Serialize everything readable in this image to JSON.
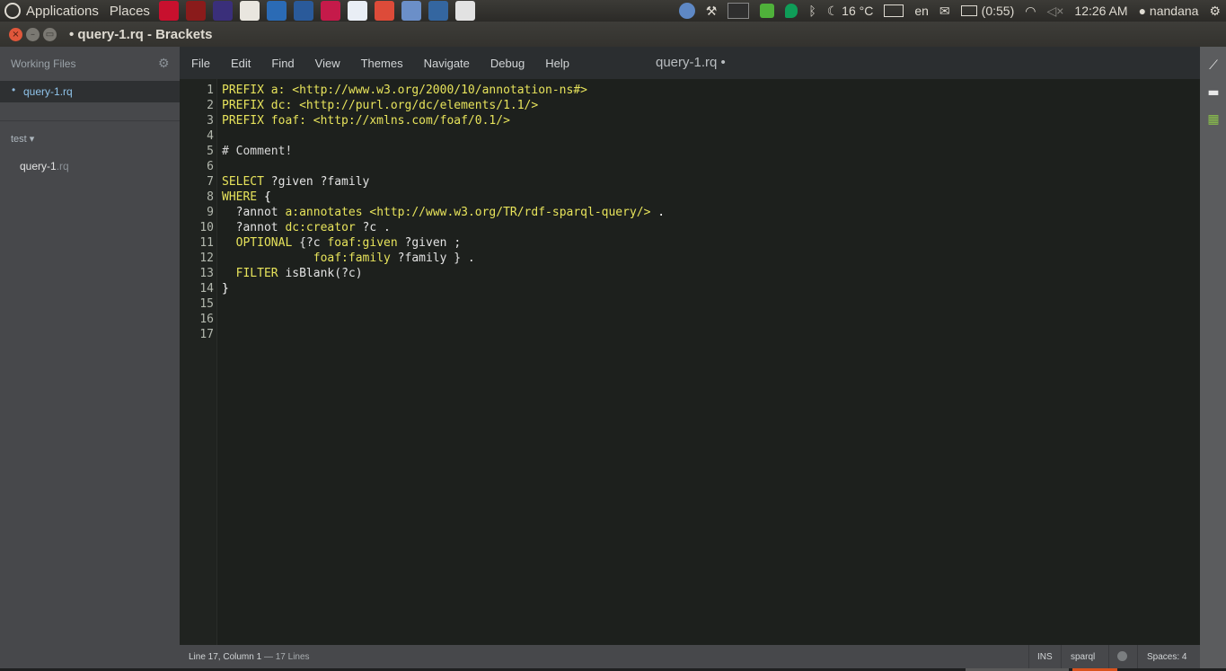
{
  "top_panel": {
    "menus": [
      "Applications",
      "Places"
    ],
    "launcher_icons": [
      {
        "name": "mendeley-icon",
        "color": "#c8102e"
      },
      {
        "name": "terminal-red-icon",
        "color": "#8a1b1b"
      },
      {
        "name": "eclipse-icon",
        "color": "#3a2f7a"
      },
      {
        "name": "text-editor-icon",
        "color": "#e9e6df"
      },
      {
        "name": "monitor-icon",
        "color": "#2b6bb5"
      },
      {
        "name": "update-icon",
        "color": "#2a5a9a"
      },
      {
        "name": "raspberry-icon",
        "color": "#c51a4a"
      },
      {
        "name": "chart-icon",
        "color": "#e9eef5"
      },
      {
        "name": "chrome-icon",
        "color": "#dd4b39"
      },
      {
        "name": "browser-icon",
        "color": "#6b8fc8"
      },
      {
        "name": "window-icon",
        "color": "#3466a0"
      },
      {
        "name": "tex-icon",
        "color": "#e2e2e2"
      }
    ],
    "tray": {
      "weather_temp": "16 °C",
      "keyboard_layout": "en",
      "battery": "(0:55)",
      "clock": "12:26 AM",
      "user": "nandana"
    }
  },
  "window": {
    "title": "• query-1.rq - Brackets",
    "close_glyph": "×",
    "minimize_glyph": "–",
    "maximize_glyph": "▭"
  },
  "sidebar": {
    "working_files_header": "Working Files",
    "working_files": [
      {
        "name": "query-1.rq",
        "dirty_marker": "•"
      }
    ],
    "project_name": "test ▾",
    "tree": [
      {
        "base": "query-1",
        "ext": ".rq"
      }
    ]
  },
  "menubar": {
    "items": [
      "File",
      "Edit",
      "Find",
      "View",
      "Themes",
      "Navigate",
      "Debug",
      "Help"
    ],
    "doc_title": "query-1.rq •"
  },
  "editor": {
    "line_numbers": [
      "1",
      "2",
      "3",
      "4",
      "5",
      "6",
      "7",
      "8",
      "9",
      "10",
      "11",
      "12",
      "13",
      "14",
      "15",
      "16",
      "17"
    ],
    "lines": [
      [
        {
          "t": "PREFIX a: <http://www.w3.org/2000/10/annotation-ns#>",
          "c": "keyword"
        }
      ],
      [
        {
          "t": "PREFIX dc: <http://purl.org/dc/elements/1.1/>",
          "c": "keyword"
        }
      ],
      [
        {
          "t": "PREFIX foaf: <http://xmlns.com/foaf/0.1/>",
          "c": "keyword"
        }
      ],
      [],
      [
        {
          "t": "# Comment!",
          "c": "comment"
        }
      ],
      [],
      [
        {
          "t": "SELECT",
          "c": "keyword"
        },
        {
          "t": " ?given ?family",
          "c": "var"
        }
      ],
      [
        {
          "t": "WHERE",
          "c": "keyword"
        },
        {
          "t": " {",
          "c": "punct"
        }
      ],
      [
        {
          "t": "  ?annot ",
          "c": "var"
        },
        {
          "t": "a:annotates <http://www.w3.org/TR/rdf-sparql-query/>",
          "c": "prefix"
        },
        {
          "t": " .",
          "c": "punct"
        }
      ],
      [
        {
          "t": "  ?annot ",
          "c": "var"
        },
        {
          "t": "dc:creator",
          "c": "prefix"
        },
        {
          "t": " ?c .",
          "c": "var"
        }
      ],
      [
        {
          "t": "  ",
          "c": "punct"
        },
        {
          "t": "OPTIONAL",
          "c": "keyword"
        },
        {
          "t": " {?c ",
          "c": "var"
        },
        {
          "t": "foaf:given",
          "c": "prefix"
        },
        {
          "t": " ?given ;",
          "c": "var"
        }
      ],
      [
        {
          "t": "             ",
          "c": "punct"
        },
        {
          "t": "foaf:family",
          "c": "prefix"
        },
        {
          "t": " ?family } .",
          "c": "var"
        }
      ],
      [
        {
          "t": "  ",
          "c": "punct"
        },
        {
          "t": "FILTER",
          "c": "keyword"
        },
        {
          "t": " isBlank(?c)",
          "c": "var"
        }
      ],
      [
        {
          "t": "}",
          "c": "punct"
        }
      ],
      [],
      [],
      []
    ]
  },
  "statusbar": {
    "cursor": "Line 17, Column 1",
    "lines": " — 17 Lines",
    "mode": "INS",
    "language": "sparql",
    "spaces": "Spaces: 4"
  }
}
